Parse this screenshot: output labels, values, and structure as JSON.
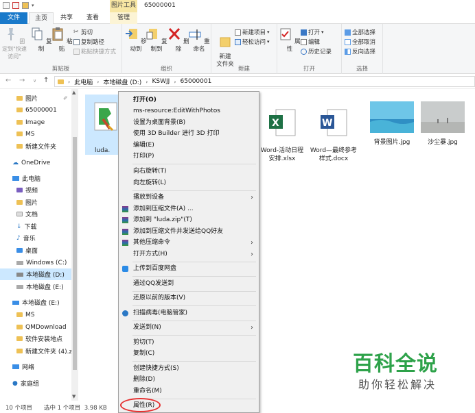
{
  "title_bar": {
    "context_tab_group": "图片工具",
    "window_title": "65000001"
  },
  "tabs": {
    "file": "文件",
    "home": "主页",
    "share": "共享",
    "view": "查看",
    "manage": "管理"
  },
  "ribbon": {
    "clipboard": {
      "label": "剪贴板",
      "pin": "固定到\"快速访问\"",
      "copy": "复制",
      "paste": "粘贴",
      "cut": "剪切",
      "copy_path": "复制路径",
      "paste_shortcut": "粘贴快捷方式"
    },
    "organize": {
      "label": "组织",
      "move_to": "移动到",
      "copy_to": "复制到",
      "delete": "删除",
      "rename": "重命名"
    },
    "new": {
      "label": "新建",
      "new_folder": "新建\n文件夹",
      "new_item": "新建项目",
      "easy_access": "轻松访问"
    },
    "open": {
      "label": "打开",
      "properties": "属性",
      "open": "打开",
      "edit": "编辑",
      "history": "历史记录"
    },
    "select": {
      "label": "选择",
      "select_all": "全部选择",
      "select_none": "全部取消",
      "invert": "反向选择"
    }
  },
  "address": {
    "crumbs": [
      "此电脑",
      "本地磁盘 (D:)",
      "KSWJJ",
      "65000001"
    ]
  },
  "sidebar": {
    "items": [
      "图片",
      "65000001",
      "Image",
      "MS",
      "新建文件夹",
      "OneDrive",
      "此电脑",
      "视频",
      "图片",
      "文档",
      "下载",
      "音乐",
      "桌面",
      "Windows (C:)",
      "本地磁盘 (D:)",
      "本地磁盘 (E:)",
      "本地磁盘 (E:)",
      "MS",
      "QMDownload",
      "软件安装地点",
      "新建文件夹 (4).z",
      "网络",
      "家庭组"
    ]
  },
  "files": {
    "luda": "luda.",
    "word_schedule": "Word-活动日程\n安排.xlsx",
    "word_ref": "Word—最终参考\n样式.docx",
    "bg_image": "背景图片.jpg",
    "sandstorm": "沙尘暴.jpg"
  },
  "status": {
    "count": "10 个项目",
    "selected": "选中 1 个项目  3.98 KB"
  },
  "menu": {
    "open": "打开(O)",
    "edit_photos": "ms-resource:EditWithPhotos",
    "set_wallpaper": "设置为桌面背景(B)",
    "print_3d": "使用 3D Builder 进行 3D 打印",
    "edit": "编辑(E)",
    "print": "打印(P)",
    "rotate_right": "向右旋转(T)",
    "rotate_left": "向左旋转(L)",
    "cast": "播放到设备",
    "add_archive": "添加到压缩文件(A) ...",
    "add_zip": "添加到 \"luda.zip\"(T)",
    "add_qq": "添加到压缩文件并发送给QQ好友",
    "other_compress": "其他压缩命令",
    "open_with": "打开方式(H)",
    "baidu": "上传到百度网盘",
    "qq_send": "通过QQ发送到",
    "restore": "还原以前的版本(V)",
    "scan": "扫描病毒(电脑管家)",
    "send_to": "发送到(N)",
    "cut": "剪切(T)",
    "copy": "复制(C)",
    "shortcut": "创建快捷方式(S)",
    "delete": "删除(D)",
    "rename": "重命名(M)",
    "properties": "属性(R)"
  },
  "watermark": {
    "line1": "百科全说",
    "line2": "助你轻松解决"
  }
}
